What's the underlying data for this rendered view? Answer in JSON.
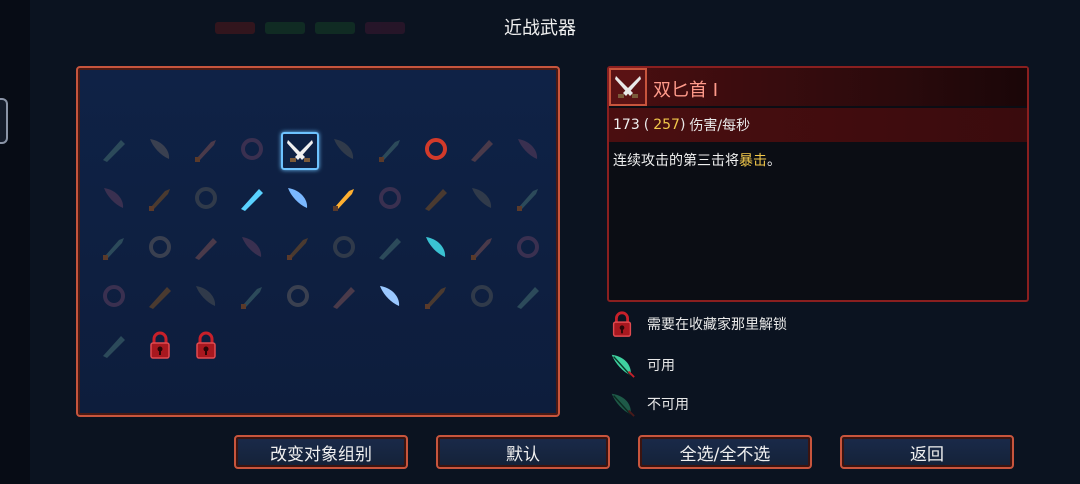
{
  "window": {
    "title": "近战武器"
  },
  "detail": {
    "name": "双匕首 I",
    "dps_value": "173",
    "dps_alt": "257",
    "dps_unit": "伤害/每秒",
    "desc_prefix": "连续攻击的第三击将",
    "desc_keyword": "暴击",
    "desc_suffix": "。"
  },
  "legend": {
    "locked": "需要在收藏家那里解锁",
    "available": "可用",
    "unavailable": "不可用"
  },
  "buttons": {
    "change_group": "改变对象组别",
    "default": "默认",
    "toggle_all": "全选/全不选",
    "back": "返回"
  },
  "colors": {
    "accent_border": "#c8553d",
    "highlight_yellow": "#f2c84b",
    "selection_blue": "#6ec3ff"
  }
}
